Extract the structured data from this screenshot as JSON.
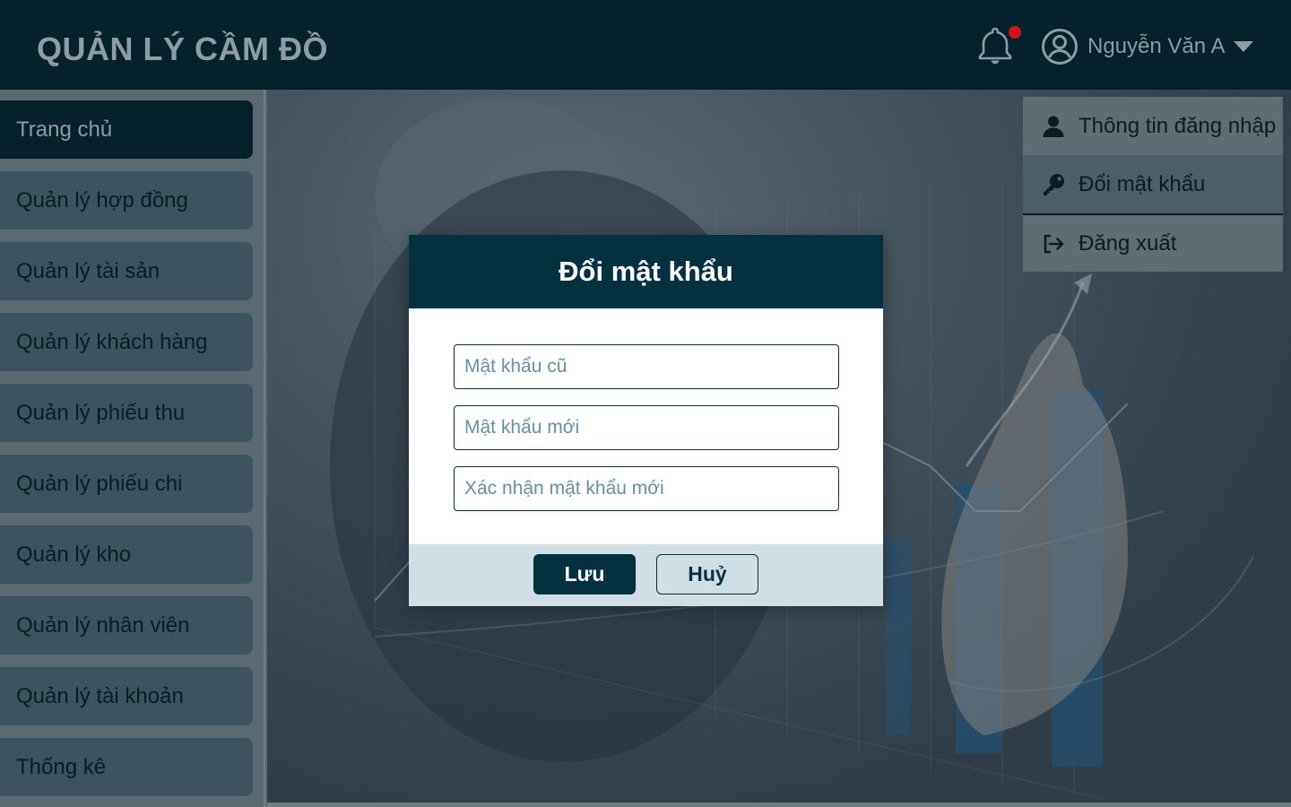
{
  "header": {
    "title": "QUẢN LÝ CẦM ĐỒ",
    "user_name": "Nguyễn Văn A",
    "has_notification": true
  },
  "sidebar": {
    "items": [
      {
        "label": "Trang chủ",
        "active": true
      },
      {
        "label": "Quản lý hợp đồng",
        "active": false
      },
      {
        "label": "Quản lý tài sản",
        "active": false
      },
      {
        "label": "Quản lý khách hàng",
        "active": false
      },
      {
        "label": "Quản lý phiếu thu",
        "active": false
      },
      {
        "label": "Quản lý phiếu chi",
        "active": false
      },
      {
        "label": "Quản lý kho",
        "active": false
      },
      {
        "label": "Quản lý nhân viên",
        "active": false
      },
      {
        "label": "Quản lý tài khoản",
        "active": false
      },
      {
        "label": "Thống kê",
        "active": false
      }
    ]
  },
  "user_menu": {
    "items": [
      {
        "label": "Thông tin đăng nhập",
        "icon": "user-icon"
      },
      {
        "label": "Đổi mật khẩu",
        "icon": "key-icon"
      },
      {
        "label": "Đăng xuất",
        "icon": "logout-icon"
      }
    ]
  },
  "modal": {
    "title": "Đổi mật khẩu",
    "old_password": {
      "placeholder": "Mật khẩu cũ",
      "value": ""
    },
    "new_password": {
      "placeholder": "Mật khẩu mới",
      "value": ""
    },
    "confirm_password": {
      "placeholder": "Xác nhận mật khẩu mới",
      "value": ""
    },
    "save_label": "Lưu",
    "cancel_label": "Huỷ"
  },
  "colors": {
    "header_bg": "#05212b",
    "modal_header_bg": "#05303f",
    "notification_dot": "#d3131a",
    "modal_footer_bg": "#d0dfe5"
  }
}
